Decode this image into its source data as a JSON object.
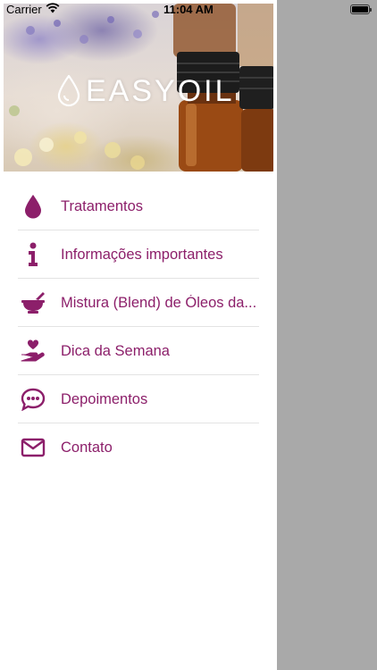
{
  "status_bar": {
    "carrier": "Carrier",
    "time": "11:04 AM"
  },
  "header": {
    "logo_text": "EASYOIL"
  },
  "menu": {
    "items": [
      {
        "label": "Tratamentos",
        "icon": "drop-icon"
      },
      {
        "label": "Informações importantes",
        "icon": "info-icon"
      },
      {
        "label": "Mistura (Blend) de Óleos da...",
        "icon": "mortar-pestle-icon"
      },
      {
        "label": "Dica da Semana",
        "icon": "hand-heart-icon"
      },
      {
        "label": "Depoimentos",
        "icon": "chat-bubble-icon"
      },
      {
        "label": "Contato",
        "icon": "envelope-icon"
      }
    ]
  },
  "colors": {
    "accent": "#8c1f6a",
    "overlay": "#a9a9a9",
    "drawer_bg": "#ffffff"
  }
}
